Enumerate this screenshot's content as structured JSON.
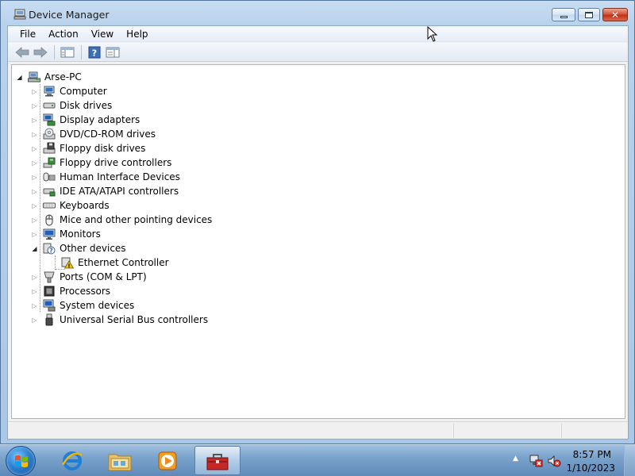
{
  "window": {
    "title": "Device Manager",
    "icon": "device-manager-icon",
    "caption_buttons": [
      "minimize",
      "maximize",
      "close"
    ]
  },
  "menubar": {
    "items": [
      "File",
      "Action",
      "View",
      "Help"
    ]
  },
  "toolbar": {
    "buttons": [
      "back-arrow-icon",
      "forward-arrow-icon",
      "show-hide-console-tree-icon",
      "help-icon",
      "properties-pane-icon"
    ]
  },
  "tree": {
    "root": {
      "label": "Arse-PC",
      "icon": "computer-tower-icon",
      "expanded": true
    },
    "categories": [
      {
        "label": "Computer",
        "icon": "computer-icon",
        "expanded": false
      },
      {
        "label": "Disk drives",
        "icon": "disk-drive-icon",
        "expanded": false
      },
      {
        "label": "Display adapters",
        "icon": "display-adapter-icon",
        "expanded": false
      },
      {
        "label": "DVD/CD-ROM drives",
        "icon": "dvd-drive-icon",
        "expanded": false
      },
      {
        "label": "Floppy disk drives",
        "icon": "floppy-disk-icon",
        "expanded": false
      },
      {
        "label": "Floppy drive controllers",
        "icon": "floppy-controller-icon",
        "expanded": false
      },
      {
        "label": "Human Interface Devices",
        "icon": "hid-icon",
        "expanded": false
      },
      {
        "label": "IDE ATA/ATAPI controllers",
        "icon": "ide-controller-icon",
        "expanded": false
      },
      {
        "label": "Keyboards",
        "icon": "keyboard-icon",
        "expanded": false
      },
      {
        "label": "Mice and other pointing devices",
        "icon": "mouse-icon",
        "expanded": false
      },
      {
        "label": "Monitors",
        "icon": "monitor-icon",
        "expanded": false
      },
      {
        "label": "Other devices",
        "icon": "unknown-device-icon",
        "expanded": true,
        "children": [
          {
            "label": "Ethernet Controller",
            "icon": "warning-device-icon"
          }
        ]
      },
      {
        "label": "Ports (COM & LPT)",
        "icon": "port-icon",
        "expanded": false
      },
      {
        "label": "Processors",
        "icon": "processor-icon",
        "expanded": false
      },
      {
        "label": "System devices",
        "icon": "system-device-icon",
        "expanded": false
      },
      {
        "label": "Universal Serial Bus controllers",
        "icon": "usb-icon",
        "expanded": false
      }
    ]
  },
  "taskbar": {
    "pinned": [
      "internet-explorer-icon",
      "windows-explorer-icon",
      "media-player-icon",
      "toolbox-icon"
    ],
    "active_index": 3,
    "clock_time": "8:57 PM",
    "clock_date": "1/10/2023",
    "tray_icons": [
      "show-hidden-icons-arrow-icon",
      "network-disconnected-icon",
      "volume-muted-icon"
    ]
  },
  "colors": {
    "accent": "#3f7fbf",
    "titlebar": "#c7ddf2",
    "close_button": "#c4301a",
    "warning": "#f2c500"
  }
}
